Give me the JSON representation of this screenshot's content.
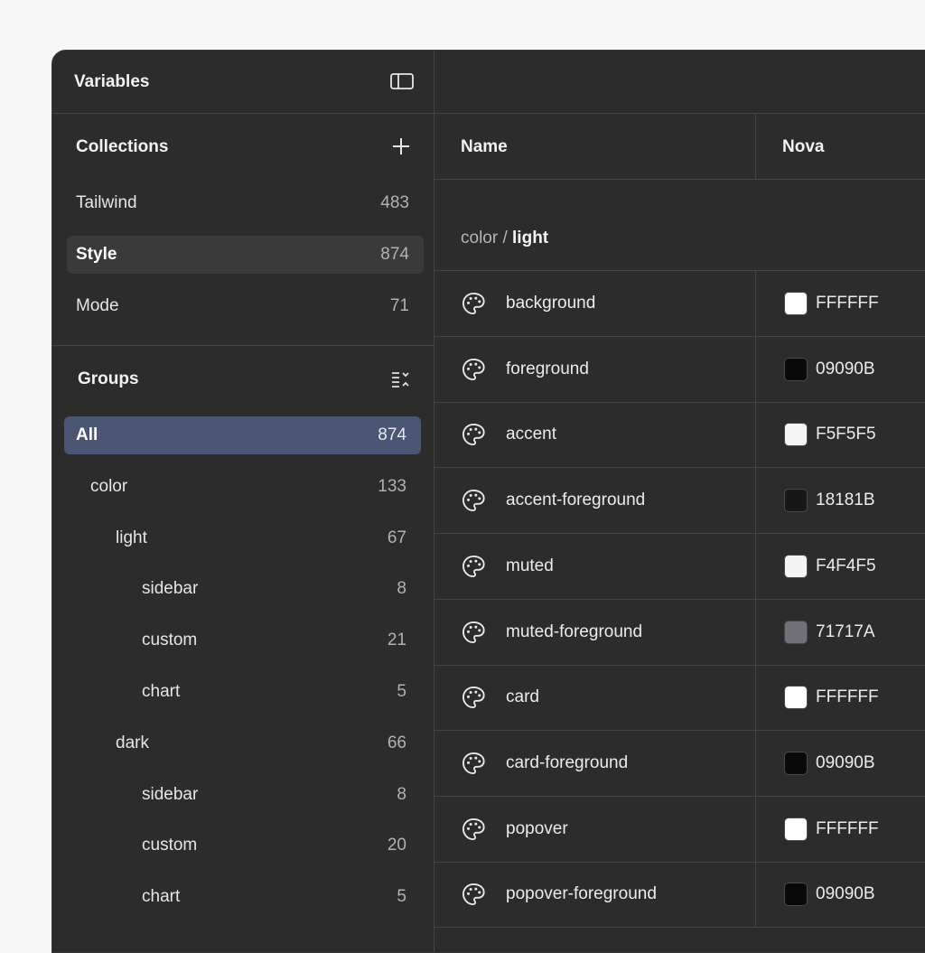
{
  "header": {
    "title": "Variables",
    "panel_icon": "sidebar-panel-icon"
  },
  "collections": {
    "title": "Collections",
    "add_icon": "plus-icon",
    "items": [
      {
        "name": "Tailwind",
        "count": "483"
      },
      {
        "name": "Style",
        "count": "874",
        "selected": true
      },
      {
        "name": "Mode",
        "count": "71"
      }
    ]
  },
  "groups": {
    "title": "Groups",
    "sort_icon": "sort-list-icon",
    "items": [
      {
        "name": "All",
        "count": "874",
        "level": 0,
        "selected": true
      },
      {
        "name": "color",
        "count": "133",
        "level": 1
      },
      {
        "name": "light",
        "count": "67",
        "level": 2
      },
      {
        "name": "sidebar",
        "count": "8",
        "level": 3
      },
      {
        "name": "custom",
        "count": "21",
        "level": 3
      },
      {
        "name": "chart",
        "count": "5",
        "level": 3
      },
      {
        "name": "dark",
        "count": "66",
        "level": 2
      },
      {
        "name": "sidebar",
        "count": "8",
        "level": 3
      },
      {
        "name": "custom",
        "count": "20",
        "level": 3
      },
      {
        "name": "chart",
        "count": "5",
        "level": 3
      }
    ]
  },
  "table": {
    "columns": [
      "Name",
      "Nova"
    ],
    "group_path": {
      "prefix": "color / ",
      "current": "light"
    },
    "rows": [
      {
        "name": "background",
        "hex": "FFFFFF",
        "color": "#FFFFFF"
      },
      {
        "name": "foreground",
        "hex": "09090B",
        "color": "#09090B"
      },
      {
        "name": "accent",
        "hex": "F5F5F5",
        "color": "#F5F5F5"
      },
      {
        "name": "accent-foreground",
        "hex": "18181B",
        "color": "#18181B"
      },
      {
        "name": "muted",
        "hex": "F4F4F5",
        "color": "#F4F4F5"
      },
      {
        "name": "muted-foreground",
        "hex": "71717A",
        "color": "#71717A"
      },
      {
        "name": "card",
        "hex": "FFFFFF",
        "color": "#FFFFFF"
      },
      {
        "name": "card-foreground",
        "hex": "09090B",
        "color": "#09090B"
      },
      {
        "name": "popover",
        "hex": "FFFFFF",
        "color": "#FFFFFF"
      },
      {
        "name": "popover-foreground",
        "hex": "09090B",
        "color": "#09090B"
      }
    ]
  },
  "colors": {
    "selected_group": "#4B5674",
    "selected_collection": "#3A3A3A",
    "window_bg": "#2C2C2C"
  }
}
